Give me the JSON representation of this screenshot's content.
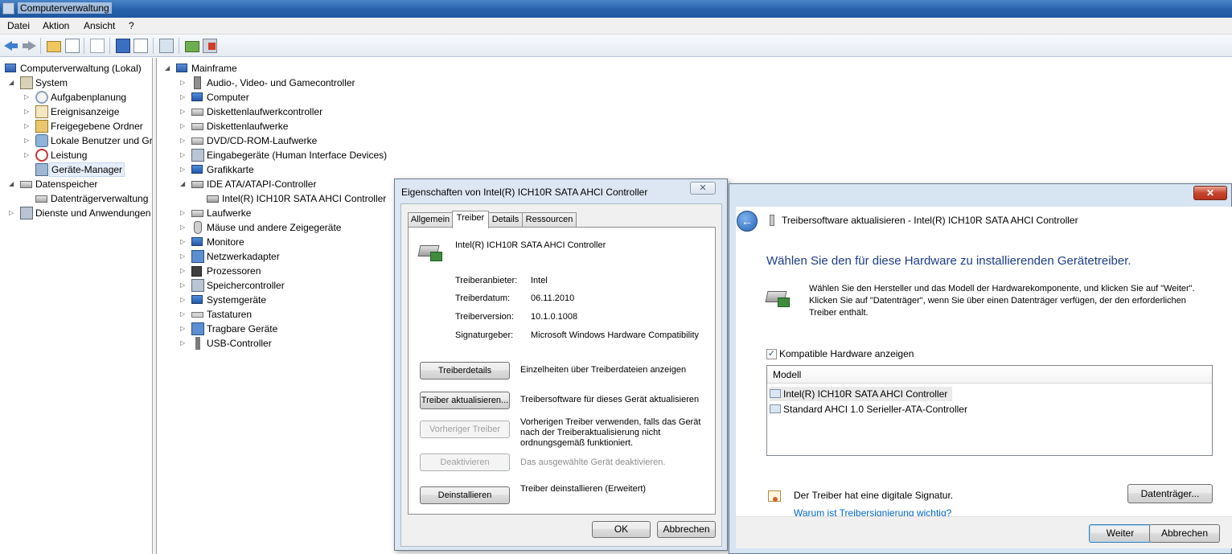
{
  "window": {
    "title": "Computerverwaltung"
  },
  "menu": {
    "items": [
      "Datei",
      "Aktion",
      "Ansicht",
      "?"
    ]
  },
  "tree": {
    "root": "Computerverwaltung (Lokal)",
    "system": "System",
    "system_items": [
      "Aufgabenplanung",
      "Ereignisanzeige",
      "Freigegebene Ordner",
      "Lokale Benutzer und Gr",
      "Leistung",
      "Geräte-Manager"
    ],
    "storage": "Datenspeicher",
    "storage_items": [
      "Datenträgerverwaltung"
    ],
    "services": "Dienste und Anwendungen"
  },
  "devices": {
    "root": "Mainframe",
    "categories": [
      "Audio-, Video- und Gamecontroller",
      "Computer",
      "Diskettenlaufwerkcontroller",
      "Diskettenlaufwerke",
      "DVD/CD-ROM-Laufwerke",
      "Eingabegeräte (Human Interface Devices)",
      "Grafikkarte",
      "IDE ATA/ATAPI-Controller",
      "Laufwerke",
      "Mäuse und andere Zeigegeräte",
      "Monitore",
      "Netzwerkadapter",
      "Prozessoren",
      "Speichercontroller",
      "Systemgeräte",
      "Tastaturen",
      "Tragbare Geräte",
      "USB-Controller"
    ],
    "ide_child": "Intel(R) ICH10R SATA AHCI Controller"
  },
  "properties": {
    "title": "Eigenschaften von Intel(R) ICH10R SATA AHCI Controller",
    "close_glyph": "✕",
    "tabs": [
      "Allgemein",
      "Treiber",
      "Details",
      "Ressourcen"
    ],
    "device_name": "Intel(R) ICH10R SATA AHCI Controller",
    "fields": [
      {
        "label": "Treiberanbieter:",
        "value": "Intel"
      },
      {
        "label": "Treiberdatum:",
        "value": "06.11.2010"
      },
      {
        "label": "Treiberversion:",
        "value": "10.1.0.1008"
      },
      {
        "label": "Signaturgeber:",
        "value": "Microsoft Windows Hardware Compatibility"
      }
    ],
    "actions": [
      {
        "button": "Treiberdetails",
        "desc": "Einzelheiten über Treiberdateien anzeigen",
        "enabled": true
      },
      {
        "button": "Treiber aktualisieren...",
        "desc": "Treibersoftware für dieses Gerät aktualisieren",
        "enabled": true
      },
      {
        "button": "Vorheriger Treiber",
        "desc": "Vorherigen Treiber verwenden, falls das Gerät nach der Treiberaktualisierung nicht ordnungsgemäß funktioniert.",
        "enabled": false
      },
      {
        "button": "Deaktivieren",
        "desc": "Das ausgewählte Gerät deaktivieren.",
        "enabled": false
      },
      {
        "button": "Deinstallieren",
        "desc": "Treiber deinstallieren (Erweitert)",
        "enabled": true
      }
    ],
    "ok": "OK",
    "cancel": "Abbrechen"
  },
  "wizard": {
    "close_glyph": "✕",
    "back_glyph": "←",
    "title": "Treibersoftware aktualisieren - Intel(R) ICH10R SATA AHCI Controller",
    "heading": "Wählen Sie den für diese Hardware zu installierenden Gerätetreiber.",
    "intro": "Wählen Sie den Hersteller und das Modell der Hardwarekomponente, und klicken Sie auf \"Weiter\". Klicken Sie auf \"Datenträger\", wenn Sie über einen Datenträger verfügen, der den erforderlichen Treiber enthält.",
    "checkbox_label": "Kompatible Hardware anzeigen",
    "checkbox_checked": true,
    "checkbox_glyph": "✓",
    "list_header": "Modell",
    "models": [
      "Intel(R) ICH10R SATA AHCI Controller",
      "Standard AHCI 1.0 Serieller-ATA-Controller"
    ],
    "selected_model_index": 0,
    "signature_text": "Der Treiber hat eine digitale Signatur.",
    "signature_link": "Warum ist Treibersignierung wichtig?",
    "disk_button": "Datenträger...",
    "next": "Weiter",
    "cancel": "Abbrechen"
  }
}
